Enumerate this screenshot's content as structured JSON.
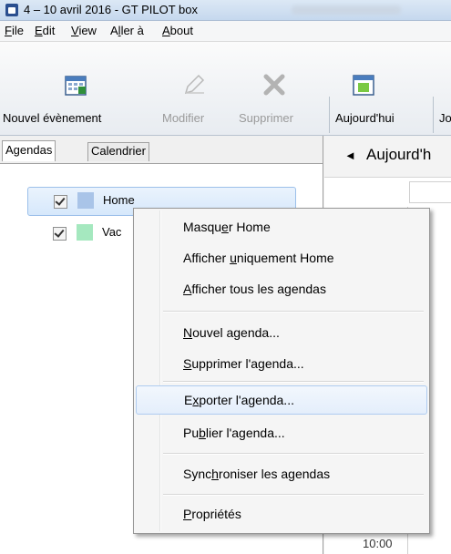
{
  "window": {
    "title": "4 – 10 avril 2016 - GT PILOT box"
  },
  "menubar": [
    {
      "pre": "",
      "u": "F",
      "post": "ile"
    },
    {
      "pre": "",
      "u": "E",
      "post": "dit"
    },
    {
      "pre": "",
      "u": "V",
      "post": "iew"
    },
    {
      "pre": "A",
      "u": "l",
      "post": "ler à"
    },
    {
      "pre": "",
      "u": "A",
      "post": "bout"
    }
  ],
  "toolbar": {
    "new_event": "Nouvel évènement",
    "modify": "Modifier",
    "delete": "Supprimer",
    "today": "Aujourd'hui",
    "next_partial": "Jo"
  },
  "tabs": {
    "agendas": "Agendas",
    "calendar": "Calendrier"
  },
  "calendars": [
    {
      "label": "Home",
      "color": "#a9c4e8",
      "checked": true
    },
    {
      "label": "Vac",
      "color": "#a5e8bf",
      "checked": true
    }
  ],
  "nav": {
    "arrow": "◄",
    "label": "Aujourd'h"
  },
  "time_label": "10:00",
  "context_menu": [
    {
      "pre": "Masqu",
      "u": "e",
      "post": "r Home"
    },
    {
      "pre": "Afficher ",
      "u": "u",
      "post": "niquement Home"
    },
    {
      "pre": "",
      "u": "A",
      "post": "fficher tous les agendas"
    },
    {
      "pre": "",
      "u": "N",
      "post": "ouvel agenda..."
    },
    {
      "pre": "",
      "u": "S",
      "post": "upprimer l'agenda..."
    },
    {
      "pre": "E",
      "u": "x",
      "post": "porter l'agenda..."
    },
    {
      "pre": "Pu",
      "u": "b",
      "post": "lier l'agenda..."
    },
    {
      "pre": "Sync",
      "u": "h",
      "post": "roniser les agendas"
    },
    {
      "pre": "",
      "u": "P",
      "post": "ropriétés"
    }
  ]
}
